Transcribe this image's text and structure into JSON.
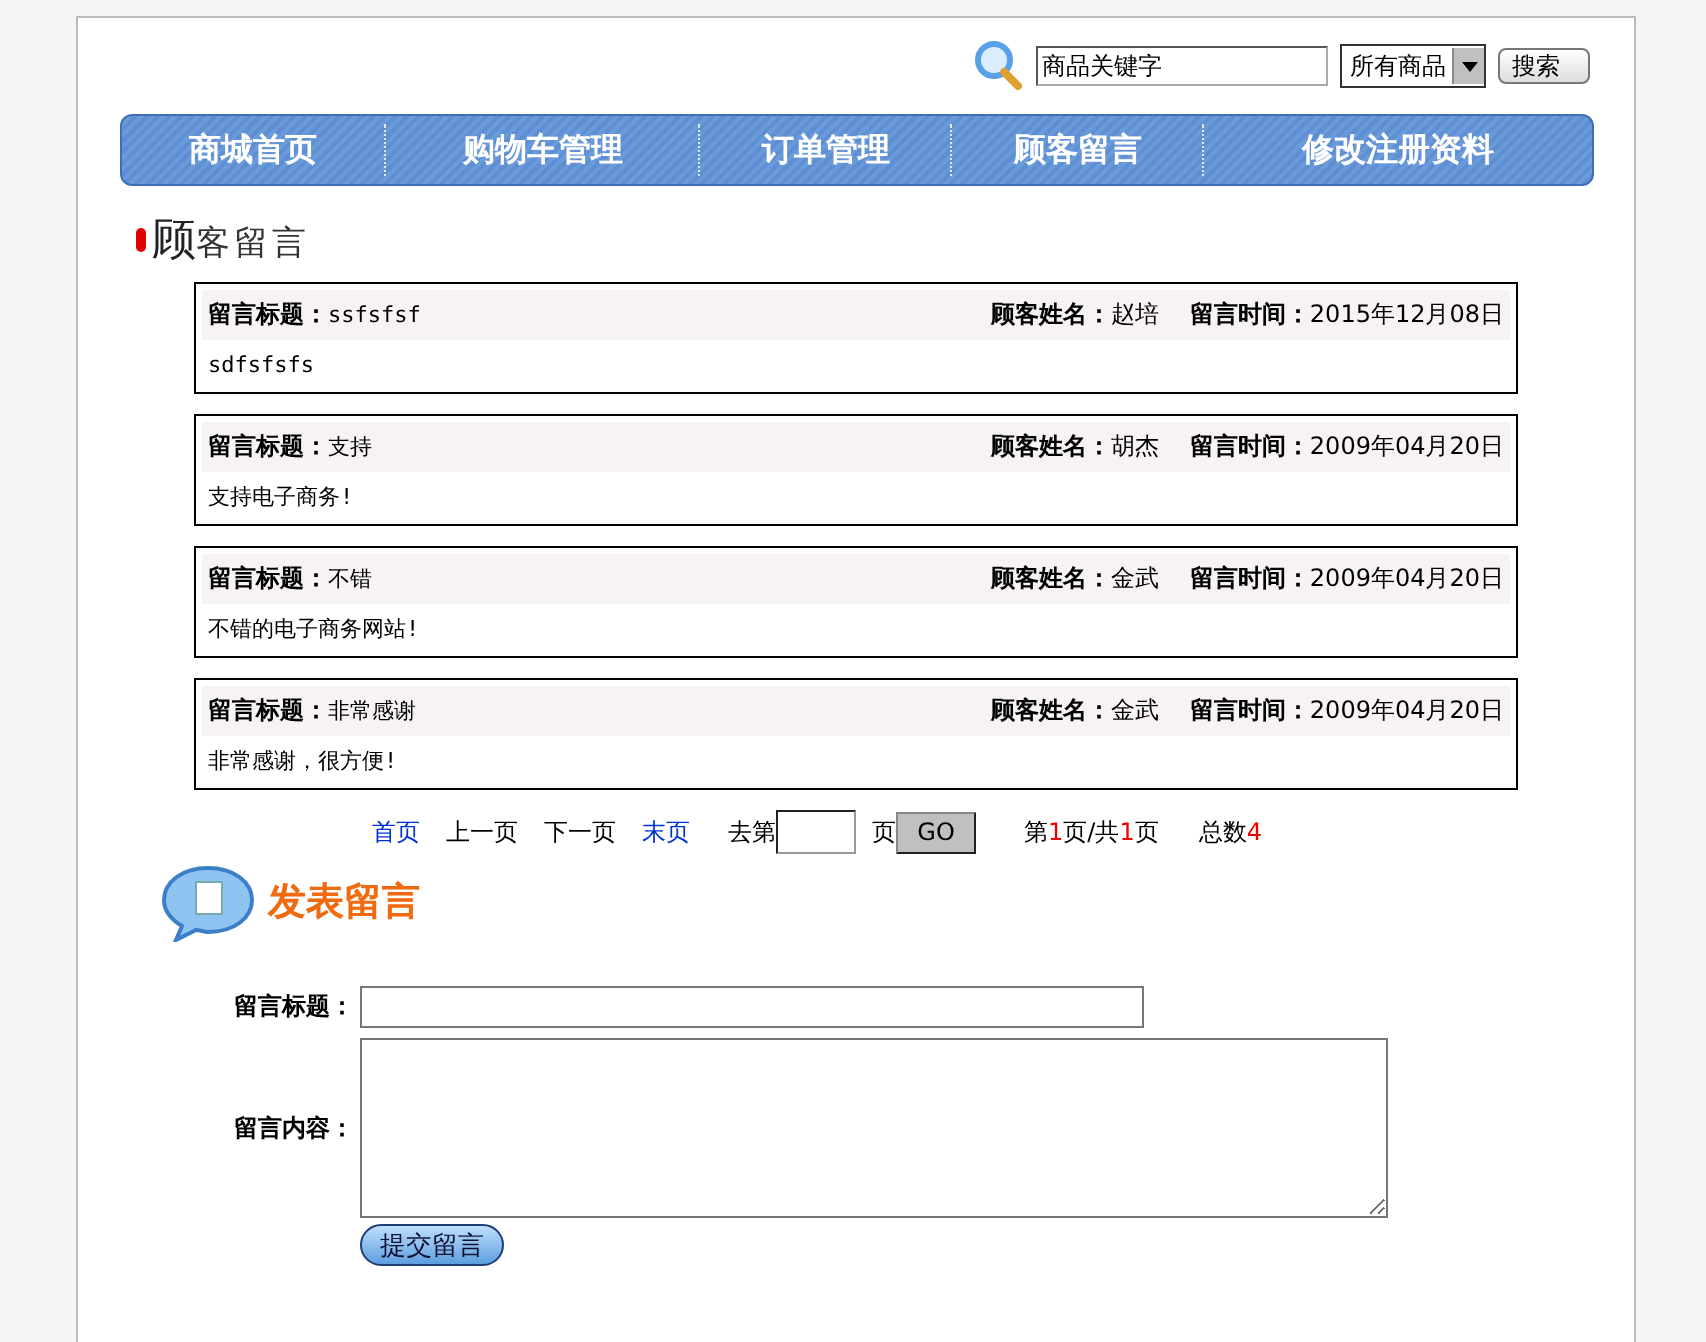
{
  "search": {
    "value": "商品关键字",
    "category": "所有商品",
    "button": "搜索"
  },
  "nav": [
    {
      "label": "商城首页"
    },
    {
      "label": "购物车管理"
    },
    {
      "label": "订单管理"
    },
    {
      "label": "顾客留言"
    },
    {
      "label": "修改注册资料"
    }
  ],
  "heading": {
    "first": "顾",
    "rest": "客留言"
  },
  "messages": [
    {
      "title_label": "留言标题：",
      "title": "ssfsfsf",
      "name_label": "顾客姓名：",
      "name": "赵培",
      "time_label": "留言时间：",
      "time": "2015年12月08日",
      "content": "sdfsfsfs"
    },
    {
      "title_label": "留言标题：",
      "title": "支持",
      "name_label": "顾客姓名：",
      "name": "胡杰",
      "time_label": "留言时间：",
      "time": "2009年04月20日",
      "content": "支持电子商务!"
    },
    {
      "title_label": "留言标题：",
      "title": "不错",
      "name_label": "顾客姓名：",
      "name": "金武",
      "time_label": "留言时间：",
      "time": "2009年04月20日",
      "content": "不错的电子商务网站!"
    },
    {
      "title_label": "留言标题：",
      "title": "非常感谢",
      "name_label": "顾客姓名：",
      "name": "金武",
      "time_label": "留言时间：",
      "time": "2009年04月20日",
      "content": "非常感谢，很方便!"
    }
  ],
  "pager": {
    "links": [
      {
        "label": "首页",
        "enabled": true
      },
      {
        "label": "上一页",
        "enabled": false
      },
      {
        "label": "下一页",
        "enabled": false
      },
      {
        "label": "末页",
        "enabled": true
      }
    ],
    "goto_prefix": "去第",
    "goto_suffix": "页",
    "go_button": "GO",
    "page_info": [
      {
        "text": "第",
        "highlight": false
      },
      {
        "text": "1",
        "highlight": true
      },
      {
        "text": "页/共",
        "highlight": false
      },
      {
        "text": "1",
        "highlight": true
      },
      {
        "text": "页",
        "highlight": false
      }
    ],
    "total": [
      {
        "text": "总数",
        "highlight": false
      },
      {
        "text": "4",
        "highlight": true
      }
    ]
  },
  "post": {
    "title": "发表留言",
    "title_label": "留言标题：",
    "content_label": "留言内容：",
    "submit": "提交留言"
  }
}
